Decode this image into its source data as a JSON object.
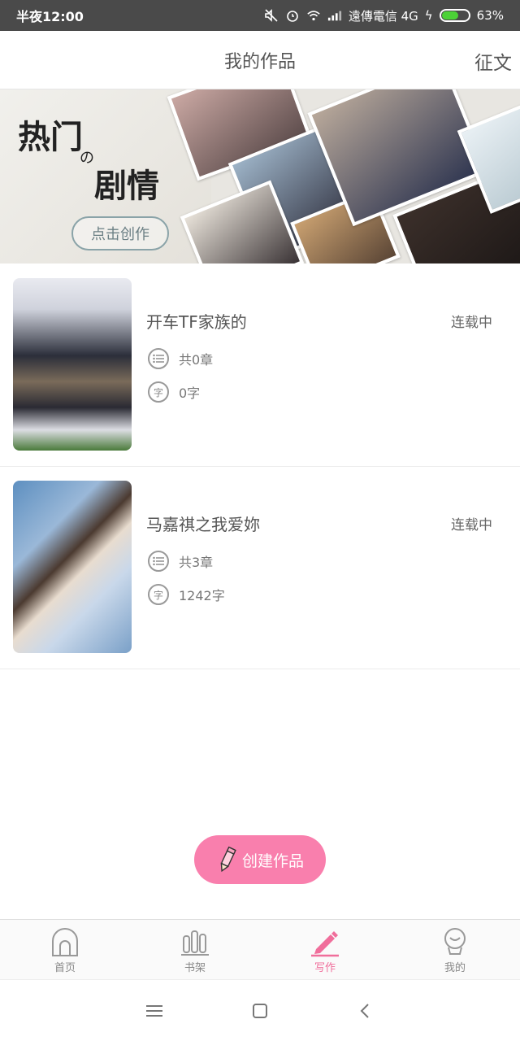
{
  "status_bar": {
    "time": "半夜12:00",
    "carrier": "遠傳電信 4G",
    "battery": "63%",
    "battery_level": 0.63
  },
  "header": {
    "title": "我的作品",
    "action": "征文"
  },
  "banner": {
    "line1": "热门",
    "connector": "の",
    "line2": "剧情",
    "button": "点击创作"
  },
  "works": [
    {
      "title": "开车TF家族的",
      "status": "连载中",
      "chapters": "共0章",
      "words": "0字"
    },
    {
      "title": "马嘉祺之我爱妳",
      "status": "连载中",
      "chapters": "共3章",
      "words": "1242字"
    }
  ],
  "create_button": "创建作品",
  "bottom_nav": [
    {
      "label": "首页",
      "icon": "home-icon"
    },
    {
      "label": "书架",
      "icon": "bookshelf-icon"
    },
    {
      "label": "写作",
      "icon": "pen-icon",
      "active": true
    },
    {
      "label": "我的",
      "icon": "profile-icon"
    }
  ],
  "colors": {
    "accent": "#f06e9b",
    "button_pink": "#f97fad"
  }
}
